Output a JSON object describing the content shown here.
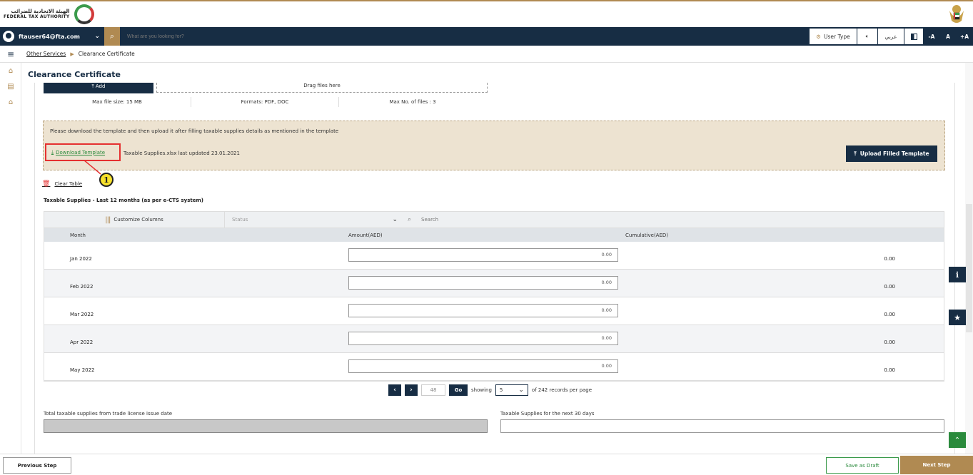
{
  "header": {
    "logo_arabic": "الهيئة الاتحادية للضرائب",
    "logo_english": "FEDERAL TAX AUTHORITY"
  },
  "topnav": {
    "user_email": "ftauser64@fta.com",
    "search_placeholder": "What are you looking for?",
    "user_type_label": "User Type",
    "arabic_label": "عربي",
    "font_minus": "-A",
    "font_normal": "A",
    "font_plus": "+A"
  },
  "breadcrumb": {
    "parent": "Other Services",
    "current": "Clearance Certificate"
  },
  "page": {
    "title": "Clearance Certificate"
  },
  "upload": {
    "add_label": "Add",
    "drag_label": "Drag files here",
    "max_size": "Max file size: 15 MB",
    "formats": "Formats: PDF, DOC",
    "max_files": "Max No. of files : 3"
  },
  "template": {
    "message": "Please download the template and then upload it after filling taxable supplies details as mentioned in the template",
    "download_label": "Download Template",
    "file_info": "Taxable Supplies.xlsx last updated 23.01.2021",
    "upload_label": "Upload Filled Template",
    "callout_number": "1"
  },
  "table": {
    "clear_label": "Clear Table",
    "section_label": "Taxable Supplies  - Last 12 months (as per e-CTS system)",
    "customize_label": "Customize Columns",
    "status_placeholder": "Status",
    "search_placeholder": "Search",
    "columns": [
      "Month",
      "Amount(AED)",
      "Cumulative(AED)"
    ],
    "rows": [
      {
        "month": "Jan 2022",
        "amount": "0.00",
        "cumulative": "0.00"
      },
      {
        "month": "Feb 2022",
        "amount": "0.00",
        "cumulative": "0.00"
      },
      {
        "month": "Mar 2022",
        "amount": "0.00",
        "cumulative": "0.00"
      },
      {
        "month": "Apr 2022",
        "amount": "0.00",
        "cumulative": "0.00"
      },
      {
        "month": "May 2022",
        "amount": "0.00",
        "cumulative": "0.00"
      }
    ]
  },
  "pagination": {
    "page_input": "48",
    "go_label": "Go",
    "showing_label": "showing",
    "per_page": "5",
    "records_text": "of 242 records per page"
  },
  "totals": {
    "left_label": "Total taxable supplies from trade license issue date",
    "right_label": "Taxable Supplies for the next 30 days"
  },
  "footer": {
    "previous_label": "Previous Step",
    "draft_label": "Save as Draft",
    "next_label": "Next Step"
  },
  "colors": {
    "navy": "#172d44",
    "gold": "#b08a52",
    "green": "#2a8a3c",
    "highlight_red": "#e53030"
  }
}
